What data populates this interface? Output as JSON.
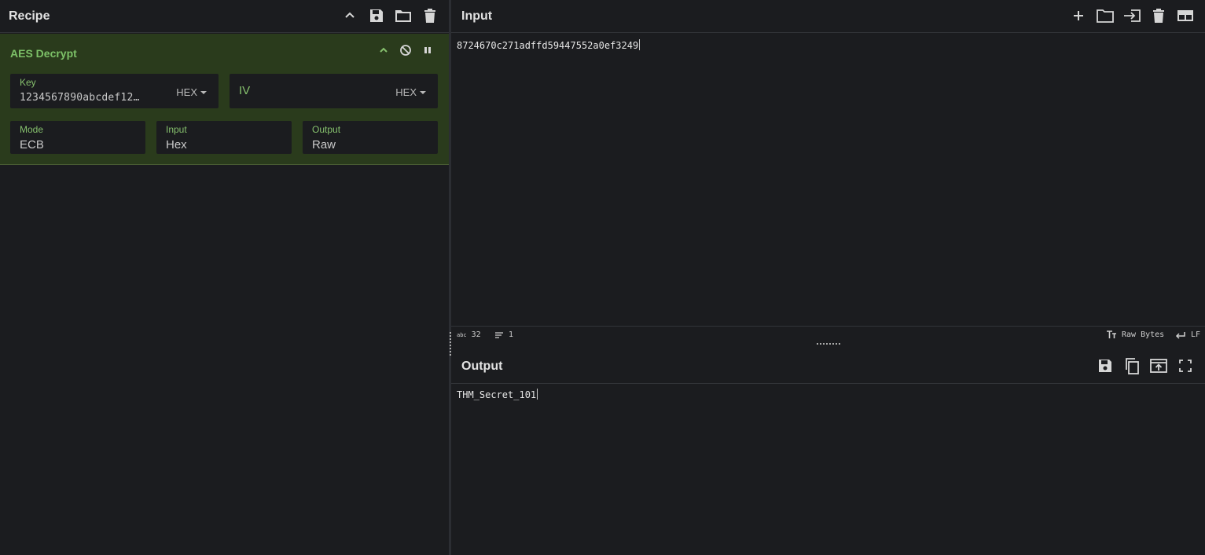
{
  "recipe": {
    "title": "Recipe",
    "icons": [
      "chevron-up-icon",
      "save-icon",
      "folder-icon",
      "trash-icon"
    ]
  },
  "operation": {
    "title": "AES Decrypt",
    "accent": "#7dc268",
    "background": "#2a3b1c",
    "key": {
      "label": "Key",
      "value": "1234567890abcdef12…",
      "format": "HEX"
    },
    "iv": {
      "placeholder": "IV",
      "format": "HEX"
    },
    "mode": {
      "label": "Mode",
      "value": "ECB"
    },
    "input": {
      "label": "Input",
      "value": "Hex"
    },
    "output": {
      "label": "Output",
      "value": "Raw"
    }
  },
  "input": {
    "title": "Input",
    "text": "8724670c271adffd59447552a0ef3249",
    "status": {
      "length_icon": "abc",
      "length": "32",
      "lines": "1",
      "encoding": "Raw Bytes",
      "eol": "LF"
    }
  },
  "output": {
    "title": "Output",
    "text": "THM_Secret_101"
  }
}
